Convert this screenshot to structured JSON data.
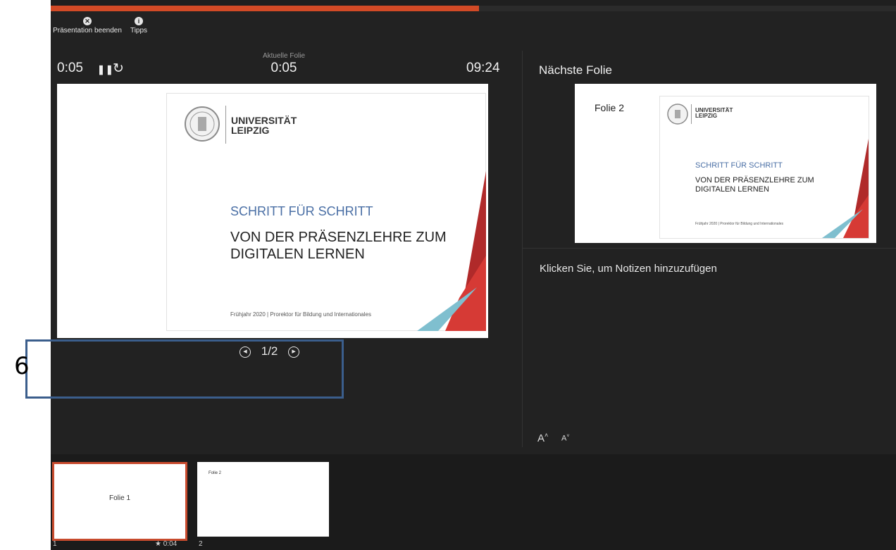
{
  "toolbar": {
    "end_show_label": "Präsentation beenden",
    "tips_label": "Tipps"
  },
  "timers": {
    "elapsed": "0:05",
    "current_slide_label": "Aktuelle Folie",
    "current_slide_time": "0:05",
    "clock": "09:24"
  },
  "progress": {
    "fraction": 0.507
  },
  "main_slide": {
    "university_line1": "UNIVERSITÄT",
    "university_line2": "LEIPZIG",
    "subtitle": "SCHRITT FÜR SCHRITT",
    "title_line1": "VON DER PRÄSENZLEHRE ZUM",
    "title_line2": "DIGITALEN LERNEN",
    "footer": "Frühjahr 2020 | Prorektor für Bildung und Internationales"
  },
  "navigation": {
    "counter": "1/2"
  },
  "next_slide": {
    "heading": "Nächste Folie",
    "slide_title": "Folie 2",
    "university_line1": "UNIVERSITÄT",
    "university_line2": "LEIPZIG",
    "subtitle": "SCHRITT FÜR SCHRITT",
    "title_line1": "VON DER PRÄSENZLEHRE ZUM",
    "title_line2": "DIGITALEN LERNEN",
    "footer": "Frühjahr 2020 | Prorektor für Bildung und Internationales"
  },
  "notes": {
    "placeholder": "Klicken Sie, um Notizen hinzuzufügen",
    "font_increase": "A",
    "font_decrease": "A"
  },
  "thumbnails": [
    {
      "label": "Folie 1",
      "number": "1",
      "timing": "★ 0:04"
    },
    {
      "label": "Folie 2",
      "number": "2"
    }
  ],
  "callout": {
    "number": "6"
  },
  "colors": {
    "accent_red": "#d24a26",
    "callout_blue": "#3b5e8c",
    "slide_blue": "#4a6fa5",
    "triangle_red": "#d63a35",
    "triangle_teal": "#7fbfcf"
  }
}
